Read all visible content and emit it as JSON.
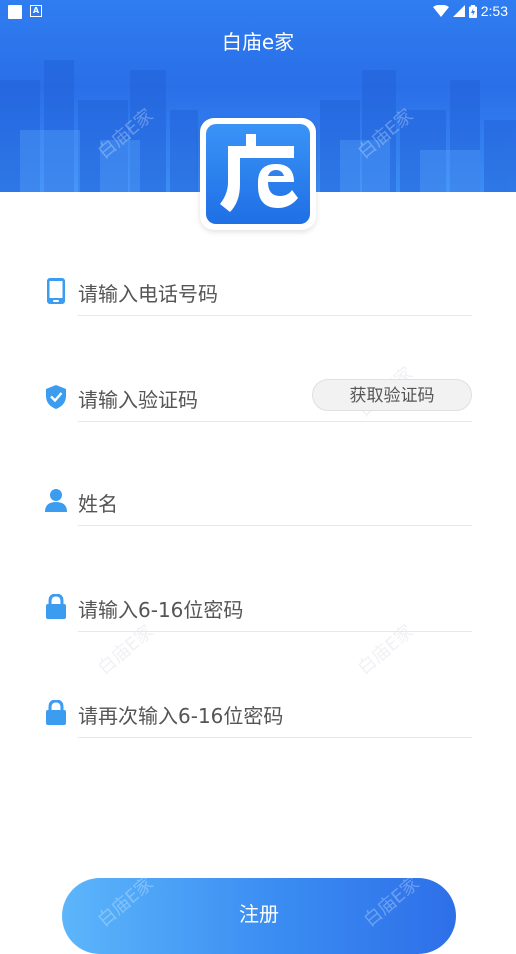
{
  "status_bar": {
    "time": "2:53"
  },
  "header": {
    "title": "白庙e家"
  },
  "logo": {
    "icon": "app-logo-icon"
  },
  "form": {
    "phone": {
      "placeholder": "请输入电话号码",
      "icon": "phone-icon"
    },
    "code": {
      "placeholder": "请输入验证码",
      "icon": "shield-check-icon",
      "button_label": "获取验证码"
    },
    "name": {
      "placeholder": "姓名",
      "icon": "user-icon"
    },
    "password": {
      "placeholder": "请输入6-16位密码",
      "icon": "lock-icon"
    },
    "password_confirm": {
      "placeholder": "请再次输入6-16位密码",
      "icon": "lock-icon"
    }
  },
  "register_button": {
    "label": "注册"
  },
  "watermark": {
    "text": "白庙E家"
  },
  "colors": {
    "accent": "#2f7df0",
    "icon_blue": "#3b9cf0",
    "button_start": "#5cb6fb",
    "button_end": "#2e6fe8"
  }
}
